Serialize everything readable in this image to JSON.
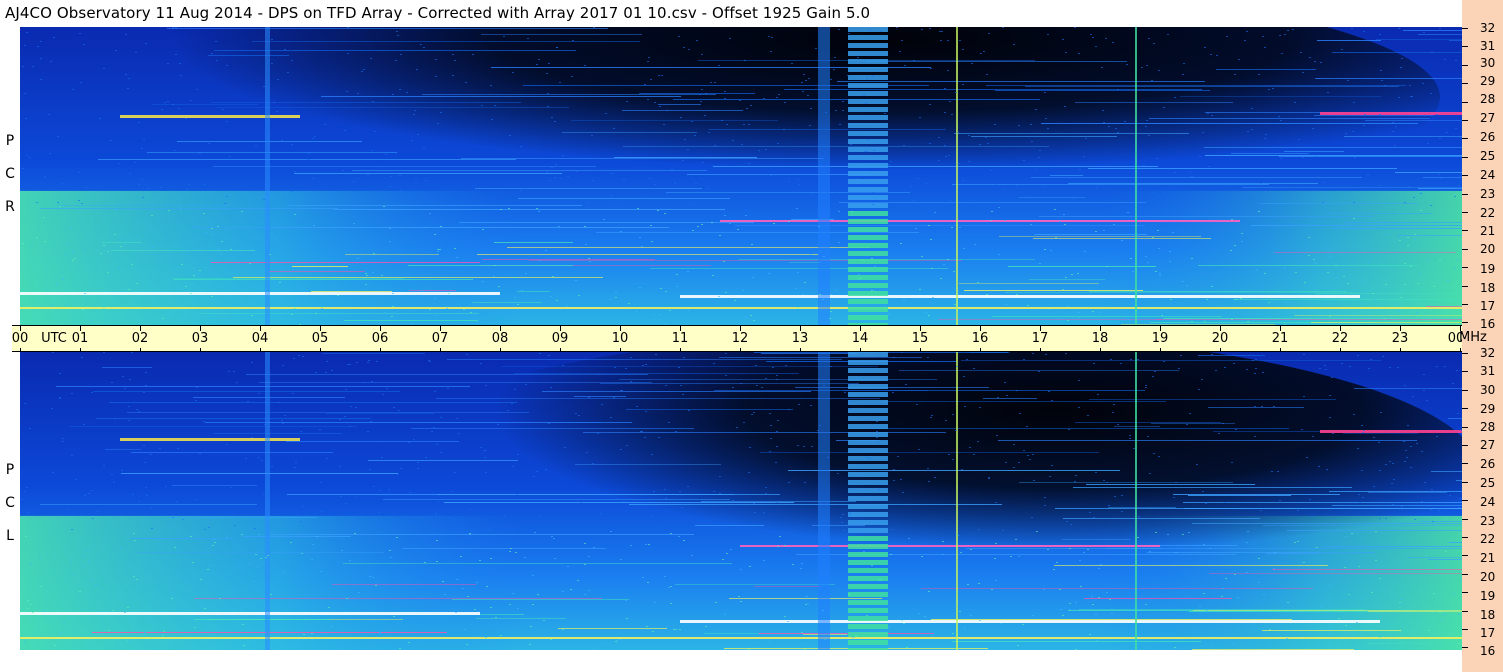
{
  "title": "AJ4CO Observatory  11 Aug 2014  -  DPS on TFD Array  -  Corrected with Array 2017 01 10.csv  -  Offset 1925  Gain 5.0",
  "polarizations": {
    "top": [
      "R",
      "C",
      "P"
    ],
    "bottom": [
      "L",
      "C",
      "P"
    ]
  },
  "time_axis": {
    "labels": [
      "00",
      "UTC",
      "01",
      "02",
      "03",
      "04",
      "05",
      "06",
      "07",
      "08",
      "09",
      "10",
      "11",
      "12",
      "13",
      "14",
      "15",
      "16",
      "17",
      "18",
      "19",
      "20",
      "21",
      "22",
      "23",
      "00"
    ],
    "unit_right": "MHz"
  },
  "freq_axis": {
    "labels": [
      "32",
      "31",
      "30",
      "29",
      "28",
      "27",
      "26",
      "25",
      "24",
      "23",
      "22",
      "21",
      "20",
      "19",
      "18",
      "17",
      "16"
    ]
  },
  "chart_data": {
    "type": "heatmap",
    "title": "AJ4CO Observatory  11 Aug 2014  -  DPS on TFD Array  -  Corrected with Array 2017 01 10.csv  -  Offset 1925  Gain 5.0",
    "xlabel": "UTC",
    "ylabel": "MHz",
    "x_range": [
      0,
      24
    ],
    "y_range": [
      16,
      32
    ],
    "x_ticks": [
      "00",
      "01",
      "02",
      "03",
      "04",
      "05",
      "06",
      "07",
      "08",
      "09",
      "10",
      "11",
      "12",
      "13",
      "14",
      "15",
      "16",
      "17",
      "18",
      "19",
      "20",
      "21",
      "22",
      "23",
      "00"
    ],
    "y_ticks": [
      16,
      17,
      18,
      19,
      20,
      21,
      22,
      23,
      24,
      25,
      26,
      27,
      28,
      29,
      30,
      31,
      32
    ],
    "panels": [
      "RCP",
      "LCP"
    ],
    "colors": {
      "low": "#000814",
      "mid_low": "#0a3fd0",
      "mid": "#1e90ff",
      "mid_high": "#3cd3c0",
      "high": "#f0f060",
      "very_high": "#ff3ca0",
      "max": "#ffffff",
      "axis_bg": "#ffffc8",
      "freq_strip_bg": "#fbd3b6"
    }
  }
}
